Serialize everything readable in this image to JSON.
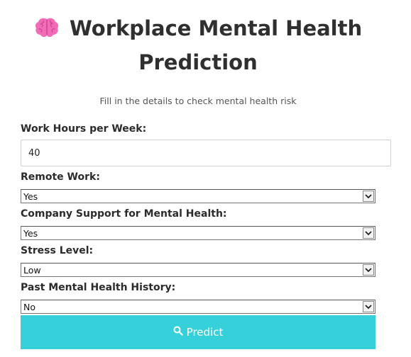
{
  "header": {
    "icon": "brain-icon",
    "title": "Workplace Mental Health Prediction",
    "subtitle": "Fill in the details to check mental health risk"
  },
  "form": {
    "work_hours": {
      "label": "Work Hours per Week:",
      "value": "40"
    },
    "remote_work": {
      "label": "Remote Work:",
      "selected": "Yes"
    },
    "company_support": {
      "label": "Company Support for Mental Health:",
      "selected": "Yes"
    },
    "stress_level": {
      "label": "Stress Level:",
      "selected": "Low"
    },
    "past_history": {
      "label": "Past Mental Health History:",
      "selected": "No"
    },
    "submit": {
      "label": "Predict",
      "icon": "search-icon"
    }
  },
  "colors": {
    "button_bg": "#35d0da",
    "button_text": "#ffffff",
    "brain_pink": "#f26bb5"
  }
}
